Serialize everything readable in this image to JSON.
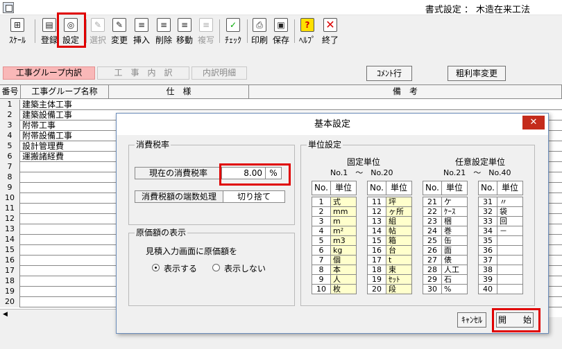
{
  "window": {
    "title": "書式設定 ： 木造在来工法"
  },
  "toolbar": {
    "scale": "ｽｹｰﾙ",
    "register": "登録",
    "settings": "設定",
    "select": "選択",
    "change": "変更",
    "insert": "挿入",
    "delete": "削除",
    "move": "移動",
    "copy": "複写",
    "check": "ﾁｪｯｸ",
    "print": "印刷",
    "save": "保存",
    "help": "ﾍﾙﾌﾟ",
    "exit": "終了"
  },
  "tabs": [
    "工事グループ内訳",
    "工　事　内　訳",
    "内訳明細"
  ],
  "buttons": {
    "comment_line": "ｺﾒﾝﾄ行",
    "gross_margin": "粗利率変更"
  },
  "grid": {
    "headers": [
      "番号",
      "工事グループ名称",
      "仕　様",
      "備　考"
    ],
    "rows": [
      {
        "num": "1",
        "name": "建築主体工事"
      },
      {
        "num": "2",
        "name": "建築設備工事"
      },
      {
        "num": "3",
        "name": "附帯工事"
      },
      {
        "num": "4",
        "name": "附帯設備工事"
      },
      {
        "num": "5",
        "name": "設計管理費"
      },
      {
        "num": "6",
        "name": "運搬諸経費"
      },
      {
        "num": "7",
        "name": ""
      },
      {
        "num": "8",
        "name": ""
      },
      {
        "num": "9",
        "name": ""
      },
      {
        "num": "10",
        "name": ""
      },
      {
        "num": "11",
        "name": ""
      },
      {
        "num": "12",
        "name": ""
      },
      {
        "num": "13",
        "name": ""
      },
      {
        "num": "14",
        "name": ""
      },
      {
        "num": "15",
        "name": ""
      },
      {
        "num": "16",
        "name": ""
      },
      {
        "num": "17",
        "name": ""
      },
      {
        "num": "18",
        "name": ""
      },
      {
        "num": "19",
        "name": ""
      },
      {
        "num": "20",
        "name": ""
      }
    ]
  },
  "dialog": {
    "title": "基本設定",
    "close": "✕",
    "tax": {
      "group_label": "消費税率",
      "rate_label": "現在の消費税率",
      "rate_value": "8.00",
      "rate_unit": "%",
      "rounding_label": "消費税額の端数処理",
      "rounding_value": "切り捨て"
    },
    "cost": {
      "group_label": "原価額の表示",
      "prompt": "見積入力画面に原価額を",
      "show": "表示する",
      "hide": "表示しない",
      "selected": "show"
    },
    "units": {
      "group_label": "単位設定",
      "fixed_title": "固定単位",
      "fixed_range": "No.1　～　No.20",
      "custom_title": "任意設定単位",
      "custom_range": "No.21　～　No.40",
      "col_no": "No.",
      "col_unit": "単位",
      "col1": [
        [
          "1",
          "式"
        ],
        [
          "2",
          "mm"
        ],
        [
          "3",
          "m"
        ],
        [
          "4",
          "m²"
        ],
        [
          "5",
          "m3"
        ],
        [
          "6",
          "kg"
        ],
        [
          "7",
          "個"
        ],
        [
          "8",
          "本"
        ],
        [
          "9",
          "人"
        ],
        [
          "10",
          "枚"
        ]
      ],
      "col2": [
        [
          "11",
          "坪"
        ],
        [
          "12",
          "ヶ所"
        ],
        [
          "13",
          "組"
        ],
        [
          "14",
          "帖"
        ],
        [
          "15",
          "箱"
        ],
        [
          "16",
          "台"
        ],
        [
          "17",
          "t"
        ],
        [
          "18",
          "束"
        ],
        [
          "19",
          "ｾｯﾄ"
        ],
        [
          "20",
          "段"
        ]
      ],
      "col3": [
        [
          "21",
          "ケ"
        ],
        [
          "22",
          "ｹｰｽ"
        ],
        [
          "23",
          "梱"
        ],
        [
          "24",
          "巻"
        ],
        [
          "25",
          "缶"
        ],
        [
          "26",
          "面"
        ],
        [
          "27",
          "俵"
        ],
        [
          "28",
          "人工"
        ],
        [
          "29",
          "石"
        ],
        [
          "30",
          "%"
        ]
      ],
      "col4": [
        [
          "31",
          "〃"
        ],
        [
          "32",
          "袋"
        ],
        [
          "33",
          "回"
        ],
        [
          "34",
          "－"
        ],
        [
          "35",
          ""
        ],
        [
          "36",
          ""
        ],
        [
          "37",
          ""
        ],
        [
          "38",
          ""
        ],
        [
          "39",
          ""
        ],
        [
          "40",
          ""
        ]
      ]
    },
    "cancel": "ｷｬﾝｾﾙ",
    "start": "開　　始"
  }
}
